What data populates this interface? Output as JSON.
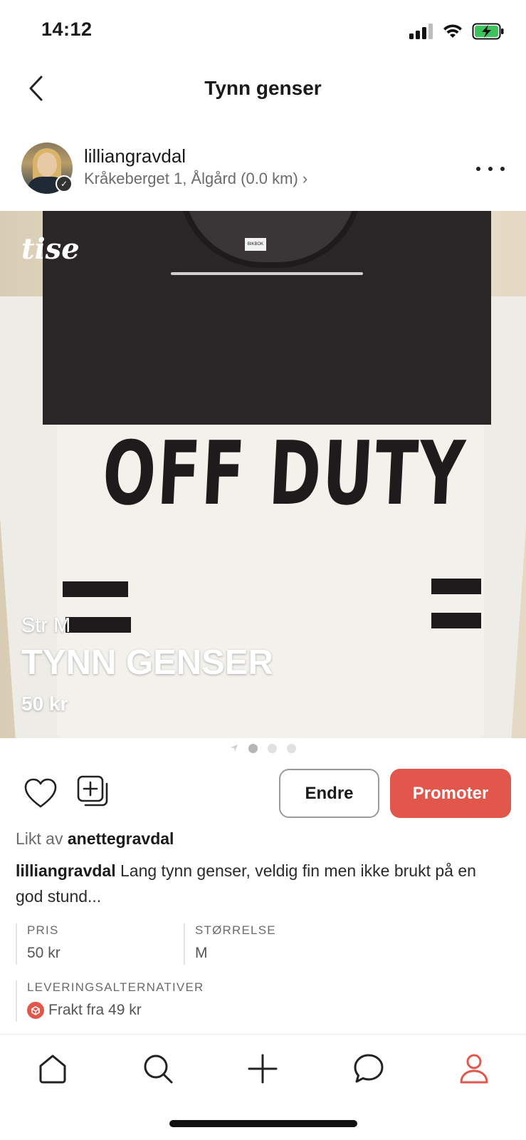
{
  "status_bar": {
    "time": "14:12"
  },
  "nav": {
    "title": "Tynn genser"
  },
  "seller": {
    "username": "lilliangravdal",
    "location": "Kråkeberget 1, Ålgård (0.0 km) ›"
  },
  "image_overlay": {
    "brand_watermark": "tise",
    "size": "Str M",
    "title": "TYNN GENSER",
    "price": "50 kr",
    "print_text": "OFF DUTY",
    "tag_text": "BIKBOK",
    "tag_size": "M"
  },
  "pager": {
    "pages": 3,
    "active_index": 0
  },
  "actions": {
    "edit_label": "Endre",
    "promote_label": "Promoter",
    "accent_color": "#e2574c"
  },
  "likes": {
    "prefix": "Likt av",
    "user": "anettegravdal"
  },
  "description": {
    "author": "lilliangravdal",
    "text": " Lang tynn genser, veldig fin men ikke brukt på en god stund..."
  },
  "details": {
    "price_label": "PRIS",
    "price_value": "50 kr",
    "size_label": "STØRRELSE",
    "size_value": "M",
    "delivery_label": "LEVERINGSALTERNATIVER",
    "delivery_value": "Frakt fra 49 kr"
  },
  "tab_bar": {
    "items": [
      "home-icon",
      "search-icon",
      "plus-icon",
      "chat-icon",
      "profile-icon"
    ],
    "active": "profile-icon"
  }
}
